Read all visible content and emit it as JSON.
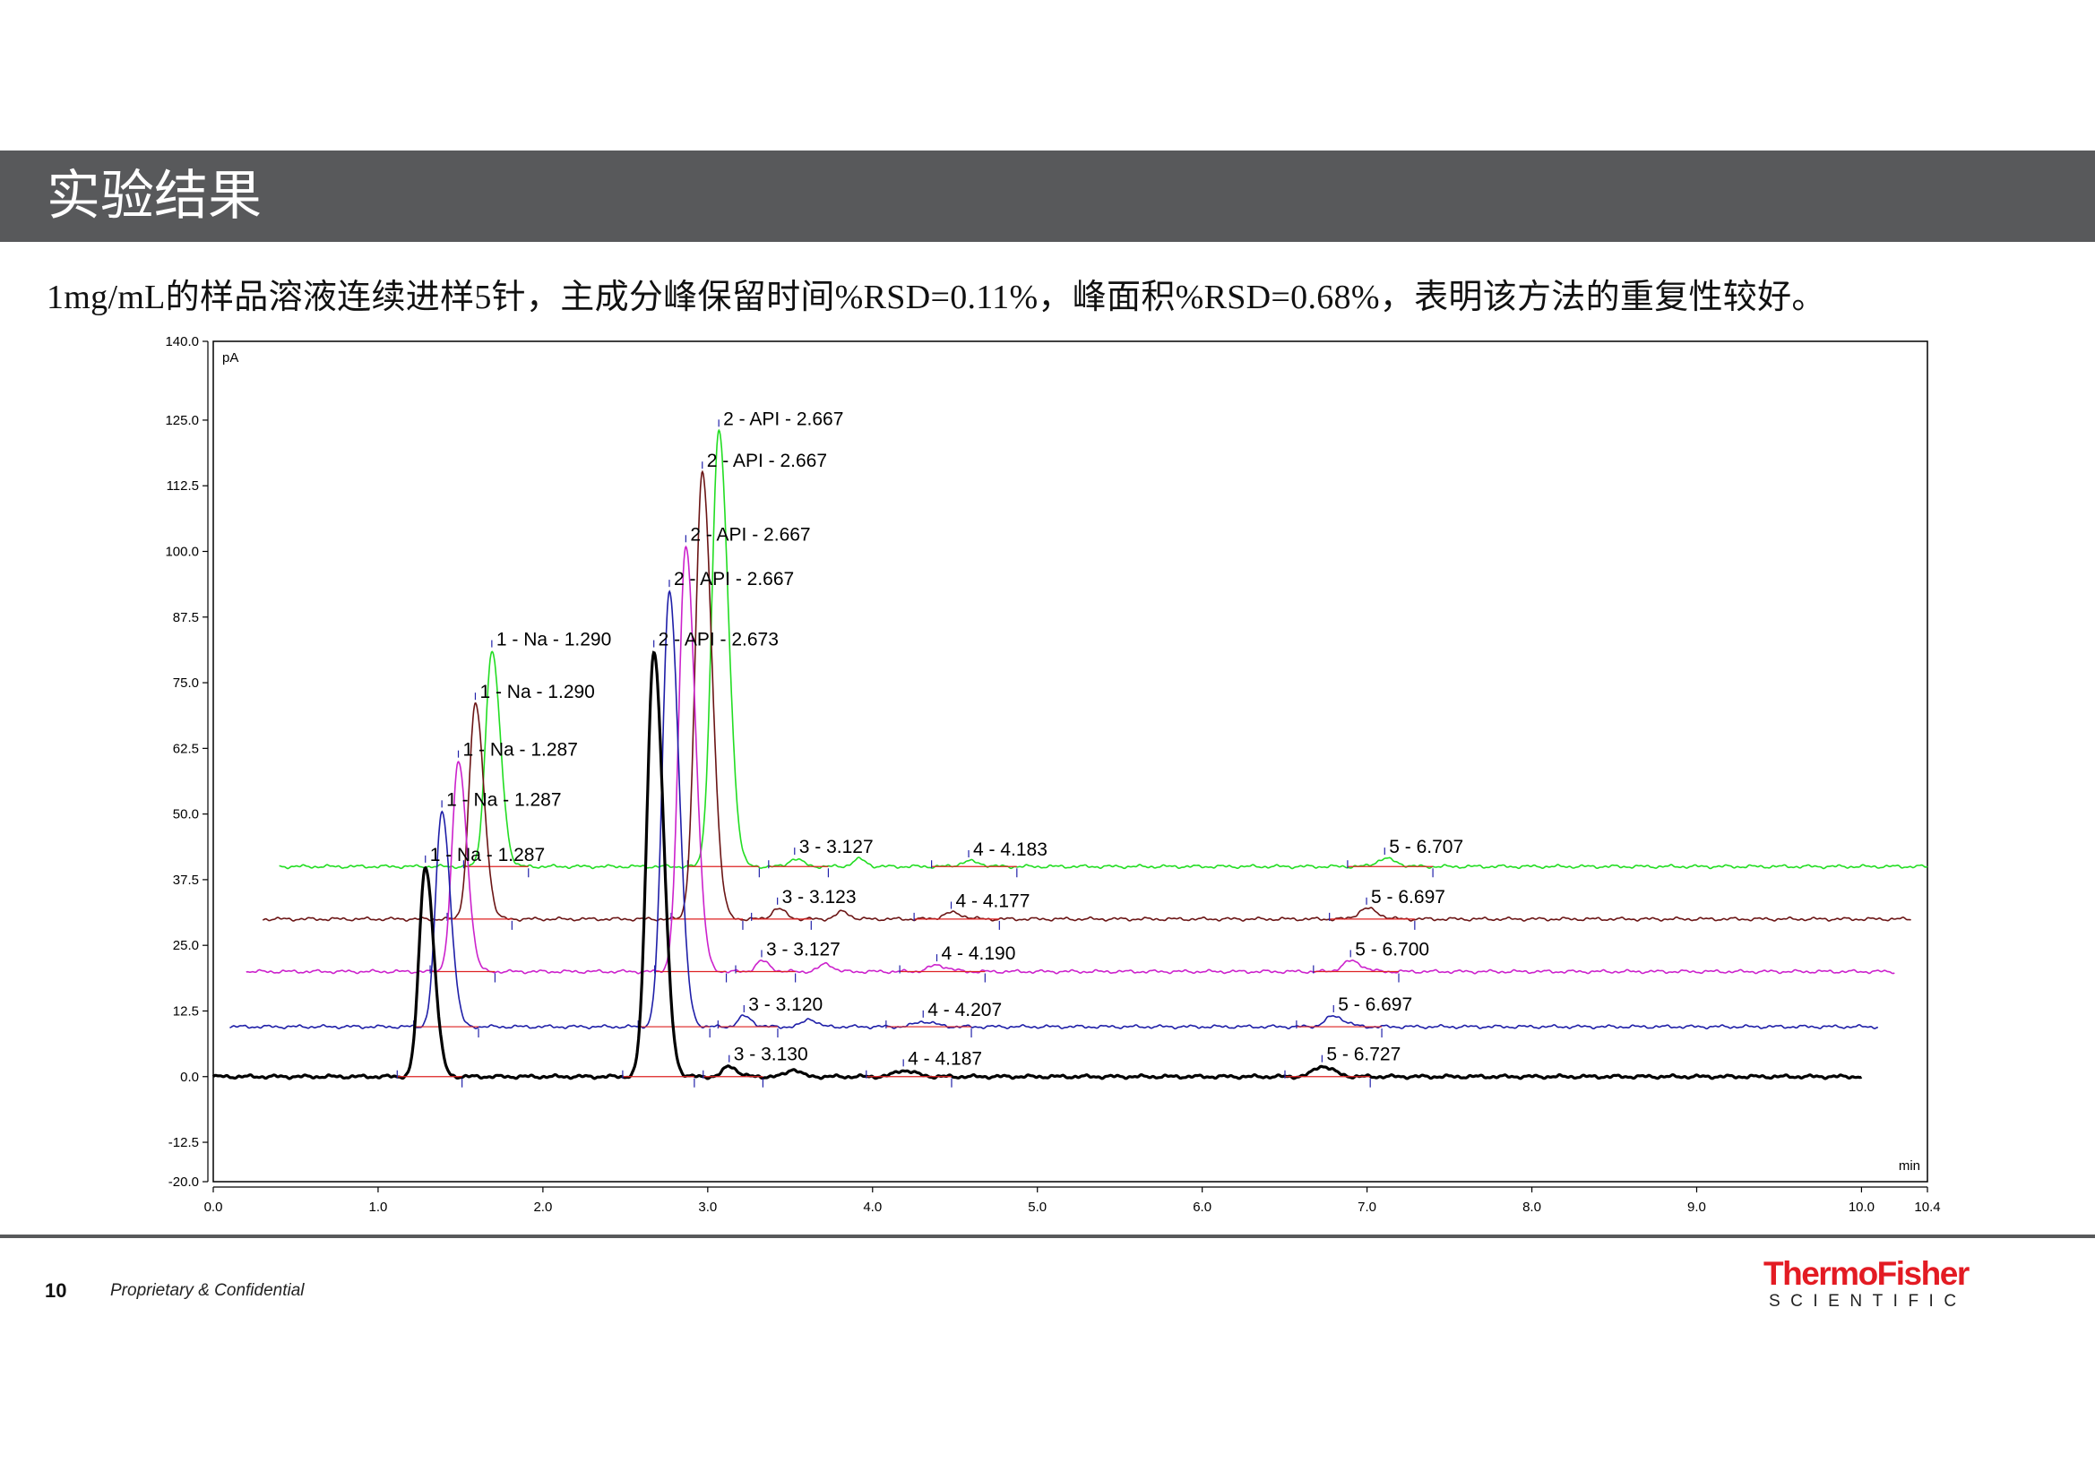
{
  "slide": {
    "title": "实验结果",
    "subtitle": "1mg/mL的样品溶液连续进样5针，主成分峰保留时间%RSD=0.11%，峰面积%RSD=0.68%，表明该方法的重复性较好。",
    "page_number": "10",
    "footer_note": "Proprietary & Confidential",
    "logo_main": "ThermoFisher",
    "logo_sub": "SCIENTIFIC",
    "logo_color": "#e31b23",
    "title_bar_color": "#58595b"
  },
  "chart_data": {
    "type": "line",
    "y_unit": "pA",
    "x_unit": "min",
    "xlim": [
      0.0,
      10.4
    ],
    "ylim": [
      -20.0,
      140.0
    ],
    "x_ticks": [
      "0.0",
      "1.0",
      "2.0",
      "3.0",
      "4.0",
      "5.0",
      "6.0",
      "7.0",
      "8.0",
      "9.0",
      "10.0",
      "10.4"
    ],
    "y_ticks": [
      "140.0",
      "125.0",
      "112.5",
      "100.0",
      "87.5",
      "75.0",
      "62.5",
      "50.0",
      "37.5",
      "25.0",
      "12.5",
      "0.0",
      "-12.5",
      "-20.0"
    ],
    "series": [
      {
        "color": "#000000",
        "x_offset": 0.0,
        "baseline": 0.0,
        "x_start": 0.0,
        "x_end": 10.0,
        "peaks": [
          {
            "t": 1.287,
            "h": 40.0,
            "label": "1 - Na - 1.287"
          },
          {
            "t": 2.673,
            "h": 81.0,
            "label": "2 - API - 2.673"
          },
          {
            "t": 3.13,
            "h": 2.0,
            "label": "3 - 3.130"
          },
          {
            "t": 4.187,
            "h": 1.2,
            "label": "4 - 4.187"
          },
          {
            "t": 6.727,
            "h": 2.0,
            "label": "5 - 6.727"
          }
        ],
        "extra_bumps": [
          {
            "t": 3.52,
            "h": 1.4
          }
        ]
      },
      {
        "color": "#1f1fa8",
        "x_offset": 0.1,
        "baseline": 9.5,
        "x_start": 0.1,
        "x_end": 10.1,
        "peaks": [
          {
            "t": 1.287,
            "h": 41.0,
            "label": "1 - Na - 1.287"
          },
          {
            "t": 2.667,
            "h": 83.0,
            "label": "2 - API - 2.667"
          },
          {
            "t": 3.12,
            "h": 2.0,
            "label": "3 - 3.120"
          },
          {
            "t": 4.207,
            "h": 1.0,
            "label": "4 - 4.207"
          },
          {
            "t": 6.697,
            "h": 2.0,
            "label": "5 - 6.697"
          }
        ],
        "extra_bumps": [
          {
            "t": 3.52,
            "h": 1.5
          }
        ]
      },
      {
        "color": "#cc22cc",
        "x_offset": 0.2,
        "baseline": 20.0,
        "x_start": 0.2,
        "x_end": 10.2,
        "peaks": [
          {
            "t": 1.287,
            "h": 40.0,
            "label": "1 - Na - 1.287"
          },
          {
            "t": 2.667,
            "h": 81.0,
            "label": "2 - API - 2.667"
          },
          {
            "t": 3.127,
            "h": 2.0,
            "label": "3 - 3.127"
          },
          {
            "t": 4.19,
            "h": 1.2,
            "label": "4 - 4.190"
          },
          {
            "t": 6.7,
            "h": 2.0,
            "label": "5 - 6.700"
          }
        ],
        "extra_bumps": [
          {
            "t": 3.52,
            "h": 1.5
          }
        ]
      },
      {
        "color": "#6b1515",
        "x_offset": 0.3,
        "baseline": 30.0,
        "x_start": 0.3,
        "x_end": 10.3,
        "peaks": [
          {
            "t": 1.29,
            "h": 41.0,
            "label": "1 - Na - 1.290"
          },
          {
            "t": 2.667,
            "h": 85.0,
            "label": "2 - API - 2.667"
          },
          {
            "t": 3.123,
            "h": 2.0,
            "label": "3 - 3.123"
          },
          {
            "t": 4.177,
            "h": 1.2,
            "label": "4 - 4.177"
          },
          {
            "t": 6.697,
            "h": 2.0,
            "label": "5 - 6.697"
          }
        ],
        "extra_bumps": [
          {
            "t": 3.52,
            "h": 1.4
          }
        ]
      },
      {
        "color": "#22dd22",
        "x_offset": 0.4,
        "baseline": 40.0,
        "x_start": 0.4,
        "x_end": 10.4,
        "peaks": [
          {
            "t": 1.29,
            "h": 41.0,
            "label": "1 - Na - 1.290"
          },
          {
            "t": 2.667,
            "h": 83.0,
            "label": "2 - API - 2.667"
          },
          {
            "t": 3.127,
            "h": 1.5,
            "label": "3 - 3.127"
          },
          {
            "t": 4.183,
            "h": 1.0,
            "label": "4 - 4.183"
          },
          {
            "t": 6.707,
            "h": 1.5,
            "label": "5 - 6.707"
          }
        ],
        "extra_bumps": [
          {
            "t": 3.52,
            "h": 1.4
          }
        ]
      }
    ],
    "integration_line_color": "#dd2222",
    "grid": false,
    "legend": "none"
  }
}
